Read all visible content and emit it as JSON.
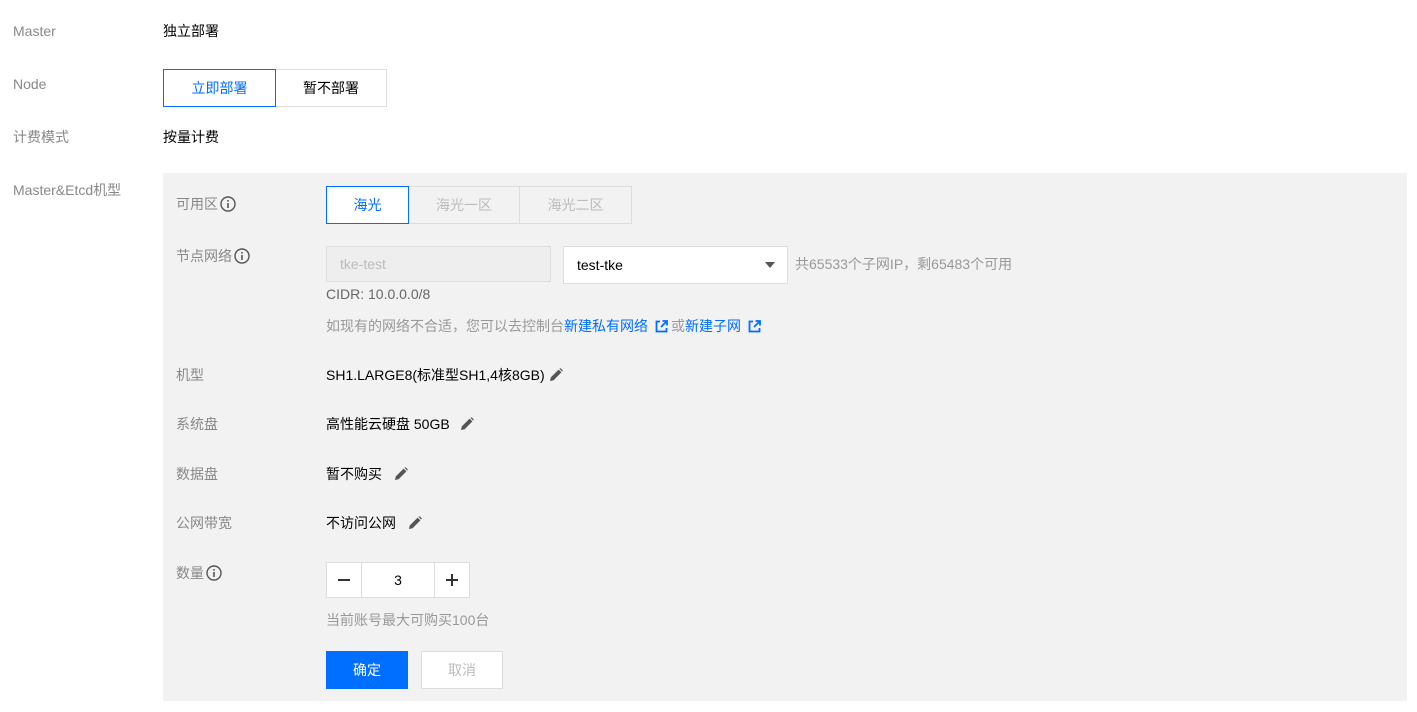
{
  "master": {
    "label": "Master",
    "value": "独立部署"
  },
  "node": {
    "label": "Node",
    "options": [
      "立即部署",
      "暂不部署"
    ],
    "selected": "立即部署"
  },
  "billing": {
    "label": "计费模式",
    "value": "按量计费"
  },
  "machine_section": {
    "label": "Master&Etcd机型"
  },
  "zone": {
    "label": "可用区",
    "options": [
      "海光",
      "海光一区",
      "海光二区"
    ],
    "selected": "海光"
  },
  "network": {
    "label": "节点网络",
    "vpc_value": "tke-test",
    "subnet_value": "test-tke",
    "subnet_info": "共65533个子网IP，剩65483个可用",
    "cidr": "CIDR: 10.0.0.0/8",
    "hint_prefix": "如现有的网络不合适，您可以去控制台",
    "link_vpc": "新建私有网络",
    "hint_or": "或",
    "link_subnet": "新建子网"
  },
  "instance_type": {
    "label": "机型",
    "value": "SH1.LARGE8(标准型SH1,4核8GB)"
  },
  "system_disk": {
    "label": "系统盘",
    "value": "高性能云硬盘 50GB"
  },
  "data_disk": {
    "label": "数据盘",
    "value": "暂不购买"
  },
  "bandwidth": {
    "label": "公网带宽",
    "value": "不访问公网"
  },
  "quantity": {
    "label": "数量",
    "value": "3",
    "hint": "当前账号最大可购买100台"
  },
  "actions": {
    "confirm": "确定",
    "cancel": "取消"
  },
  "colors": {
    "primary": "#006eff",
    "panel_bg": "#f2f2f2",
    "label": "#888888",
    "muted": "#999999"
  },
  "icons": [
    "info-icon",
    "external-link-icon",
    "pencil-icon",
    "minus-icon",
    "plus-icon",
    "caret-down-icon"
  ]
}
